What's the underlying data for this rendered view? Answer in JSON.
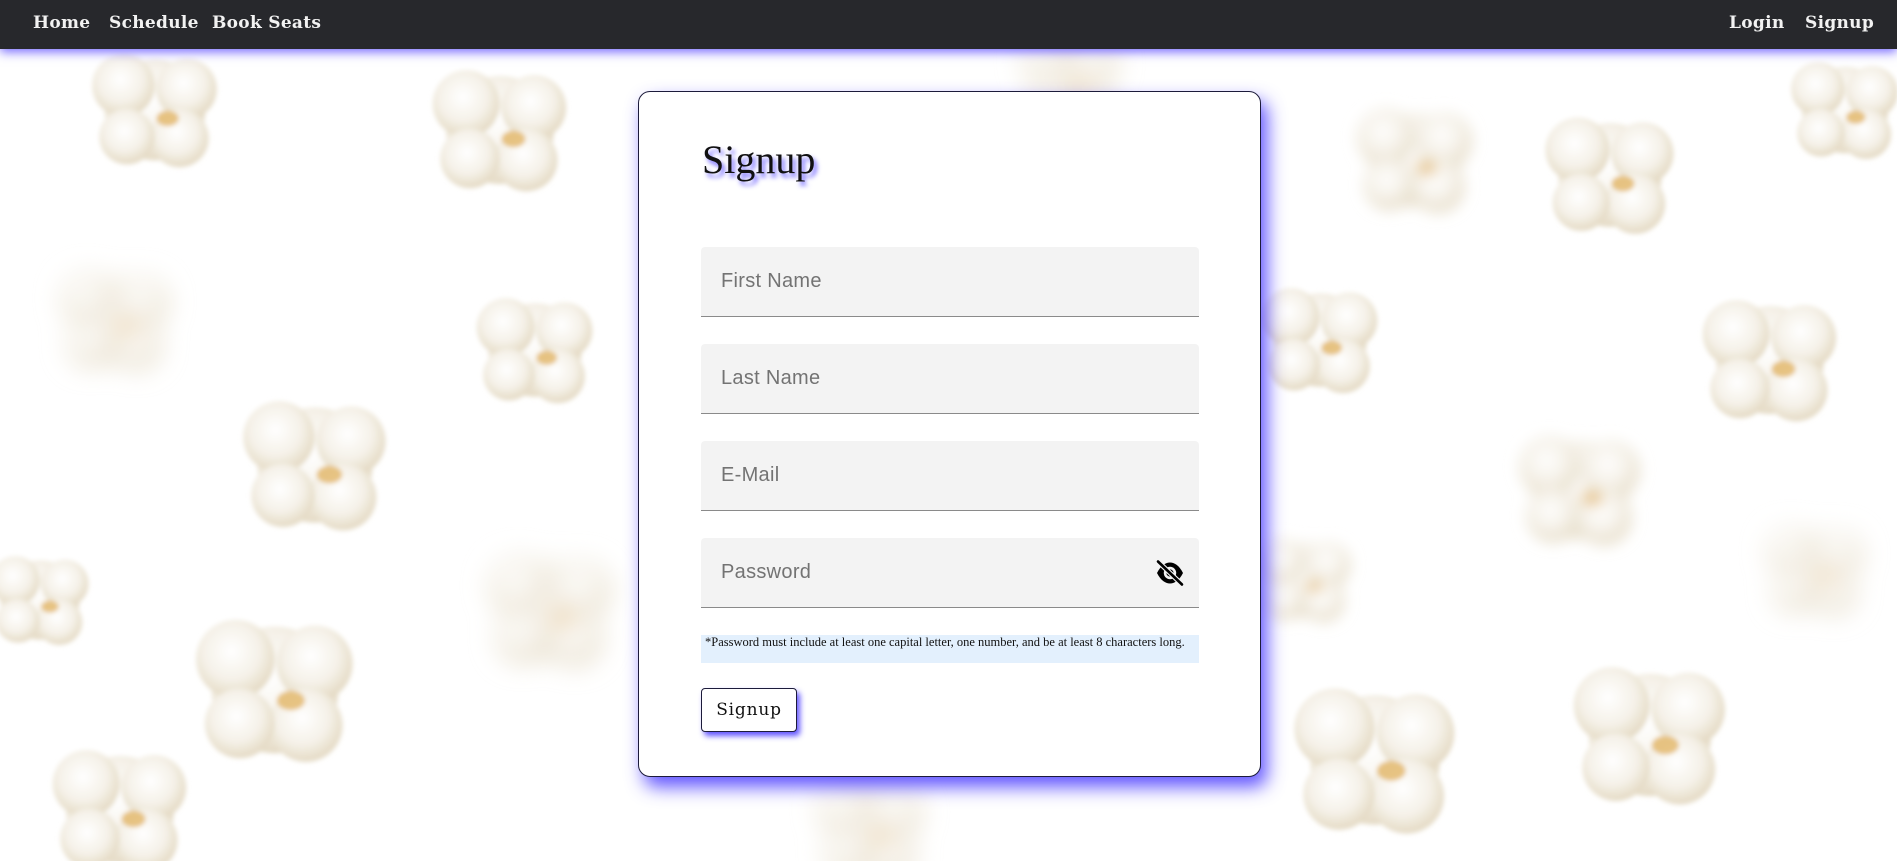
{
  "nav": {
    "home": "Home",
    "schedule": "Schedule",
    "book_seats": "Book Seats",
    "login": "Login",
    "signup": "Signup"
  },
  "form": {
    "title": "Signup",
    "first_name": {
      "value": "",
      "placeholder": "First Name"
    },
    "last_name": {
      "value": "",
      "placeholder": "Last Name"
    },
    "email": {
      "value": "",
      "placeholder": "E-Mail"
    },
    "password": {
      "value": "",
      "placeholder": "Password",
      "toggle_icon": "eye-slash-icon"
    },
    "password_hint": "*Password must include at least one capital letter, one number, and be at least 8 characters long.",
    "submit_label": "Signup"
  },
  "colors": {
    "navbar": "#27282c",
    "accent_glow": "#4637ff",
    "hint_background": "#e3f0fd",
    "field_background": "#f3f3f3"
  },
  "background": {
    "image": "popcorn-pattern"
  }
}
